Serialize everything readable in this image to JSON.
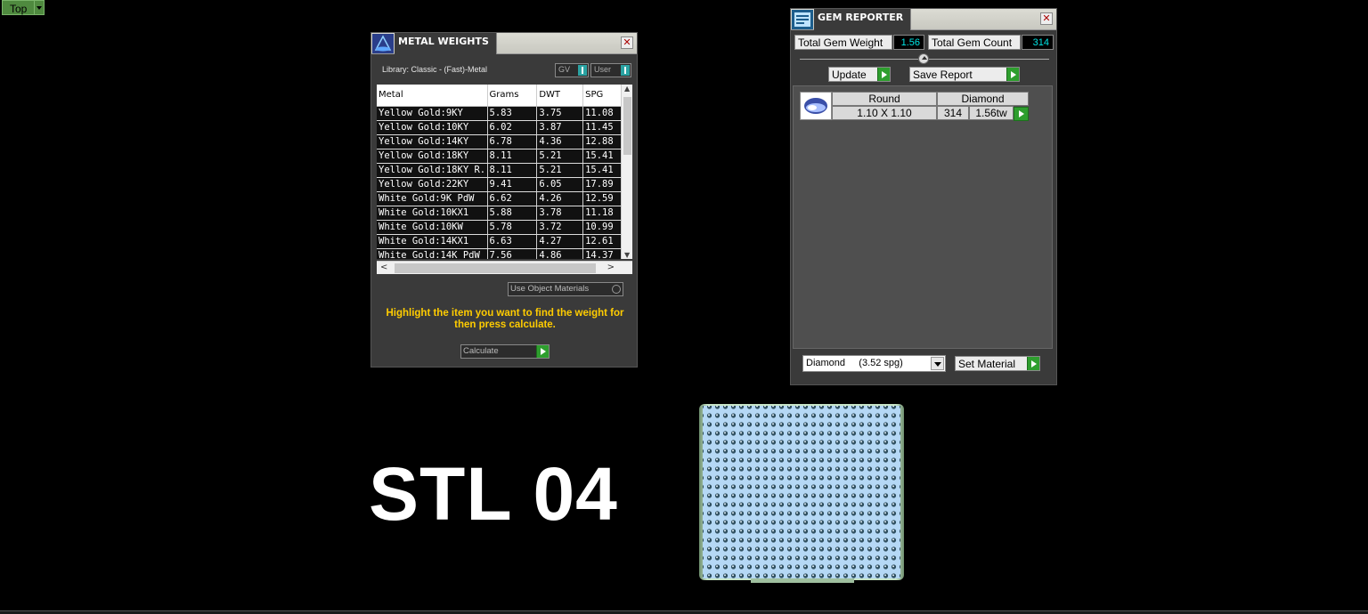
{
  "viewport": {
    "label": "Top"
  },
  "metal_weights": {
    "title": "METAL WEIGHTS",
    "library": "Library: Classic - (Fast)-Metal",
    "toggle_gv": "GV",
    "toggle_user": "User",
    "columns": [
      "Metal",
      "Grams",
      "DWT",
      "SPG"
    ],
    "rows": [
      [
        "Yellow Gold:9KY",
        "5.83",
        "3.75",
        "11.08"
      ],
      [
        "Yellow Gold:10KY",
        "6.02",
        "3.87",
        "11.45"
      ],
      [
        "Yellow Gold:14KY",
        "6.78",
        "4.36",
        "12.88"
      ],
      [
        "Yellow Gold:18KY",
        "8.11",
        "5.21",
        "15.41"
      ],
      [
        "Yellow Gold:18KY R...",
        "8.11",
        "5.21",
        "15.41"
      ],
      [
        "Yellow Gold:22KY",
        "9.41",
        "6.05",
        "17.89"
      ],
      [
        "White Gold:9K PdW",
        "6.62",
        "4.26",
        "12.59"
      ],
      [
        "White Gold:10KX1",
        "5.88",
        "3.78",
        "11.18"
      ],
      [
        "White Gold:10KW",
        "5.78",
        "3.72",
        "10.99"
      ],
      [
        "White Gold:14KX1",
        "6.63",
        "4.27",
        "12.61"
      ],
      [
        "White Gold:14K PdW",
        "7.56",
        "4.86",
        "14.37"
      ]
    ],
    "use_object_materials": "Use Object Materials",
    "hint": "Highlight the item you want to find the weight for then press calculate.",
    "calculate": "Calculate"
  },
  "gem_reporter": {
    "title": "GEM REPORTER",
    "total_weight_label": "Total Gem Weight",
    "total_weight_value": "1.56",
    "total_count_label": "Total Gem Count",
    "total_count_value": "314",
    "update": "Update",
    "save_report": "Save Report",
    "gem": {
      "shape": "Round",
      "material": "Diamond",
      "size": "1.10 X 1.10",
      "count": "314",
      "weight": "1.56tw"
    },
    "material_select": "Diamond     (3.52 spg)",
    "set_material": "Set Material"
  },
  "viewport_text": "STL 04",
  "colors": {
    "hint": "#ffcc00",
    "value_cyan": "#00e5e5",
    "go_green": "#2e9e2e"
  }
}
